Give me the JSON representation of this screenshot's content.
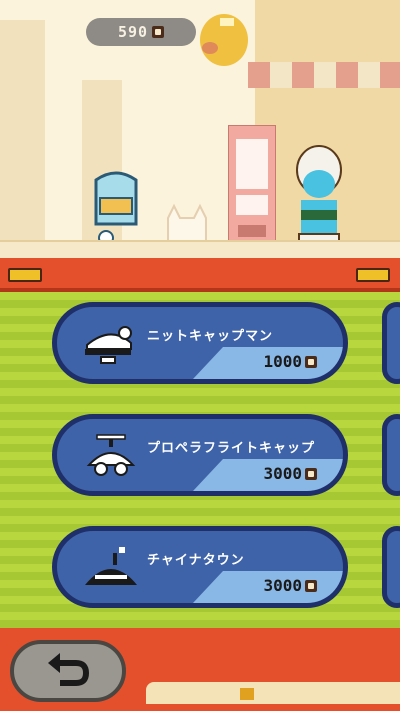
{
  "header": {
    "coins": "590"
  },
  "shop": {
    "items": [
      {
        "name": "ニットキャップマン",
        "price": "1000",
        "icon": "knit-cap-icon"
      },
      {
        "name": "プロペラフライトキャップ",
        "price": "3000",
        "icon": "propeller-cap-icon"
      },
      {
        "name": "チャイナタウン",
        "price": "3000",
        "icon": "china-hat-icon"
      }
    ]
  },
  "colors": {
    "banner": "#e4502c",
    "panel_green": "#b8d63e",
    "card_blue": "#3f63a8",
    "card_border": "#1e2f6a"
  }
}
